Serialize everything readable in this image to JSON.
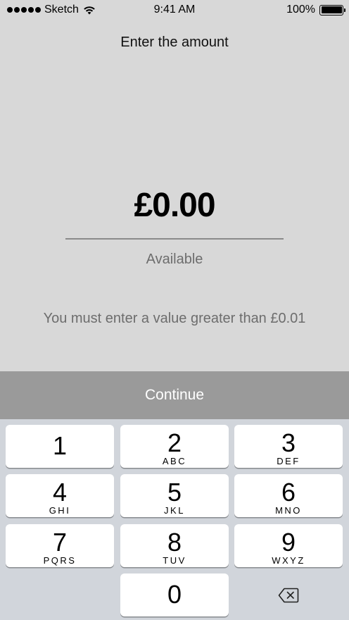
{
  "status_bar": {
    "carrier": "Sketch",
    "time": "9:41 AM",
    "battery": "100%"
  },
  "header": {
    "title": "Enter the amount"
  },
  "amount": {
    "value": "£0.00",
    "available_label": "Available",
    "validation_message": "You must enter a value greater than £0.01"
  },
  "continue_button": {
    "label": "Continue"
  },
  "keypad": {
    "keys": [
      {
        "digit": "1",
        "letters": ""
      },
      {
        "digit": "2",
        "letters": "ABC"
      },
      {
        "digit": "3",
        "letters": "DEF"
      },
      {
        "digit": "4",
        "letters": "GHI"
      },
      {
        "digit": "5",
        "letters": "JKL"
      },
      {
        "digit": "6",
        "letters": "MNO"
      },
      {
        "digit": "7",
        "letters": "PQRS"
      },
      {
        "digit": "8",
        "letters": "TUV"
      },
      {
        "digit": "9",
        "letters": "WXYZ"
      },
      {
        "digit": "0",
        "letters": ""
      }
    ],
    "backspace_icon": "delete-backspace-icon"
  },
  "colors": {
    "background": "#d8d8d8",
    "continue_disabled": "#9a9a9a",
    "keypad_background": "#d1d5db",
    "secondary_text": "#6d6d6d"
  }
}
